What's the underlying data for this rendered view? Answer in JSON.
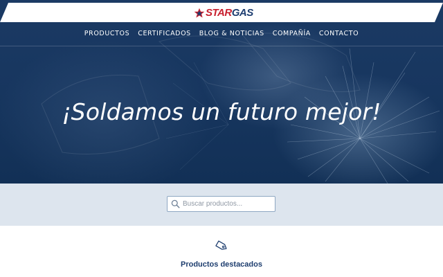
{
  "brand": {
    "logo_text_star": "STAR",
    "logo_text_gas": "GAS",
    "logo_red": "#c8202f",
    "logo_blue": "#1d3d70"
  },
  "nav": {
    "items": [
      {
        "label": "PRODUCTOS"
      },
      {
        "label": "CERTIFICADOS"
      },
      {
        "label": "BLOG & NOTICIAS"
      },
      {
        "label": "COMPAÑÍA"
      },
      {
        "label": "CONTACTO"
      }
    ]
  },
  "hero": {
    "title": "¡Soldamos un futuro mejor!",
    "background_color": "#17365f"
  },
  "search": {
    "placeholder": "Buscar productos...",
    "value": "",
    "icon": "search-icon"
  },
  "featured": {
    "icon": "tag-icon",
    "title": "Productos destacados"
  },
  "colors": {
    "search_band": "#dde5ee",
    "accent": "#1d3d6e"
  }
}
